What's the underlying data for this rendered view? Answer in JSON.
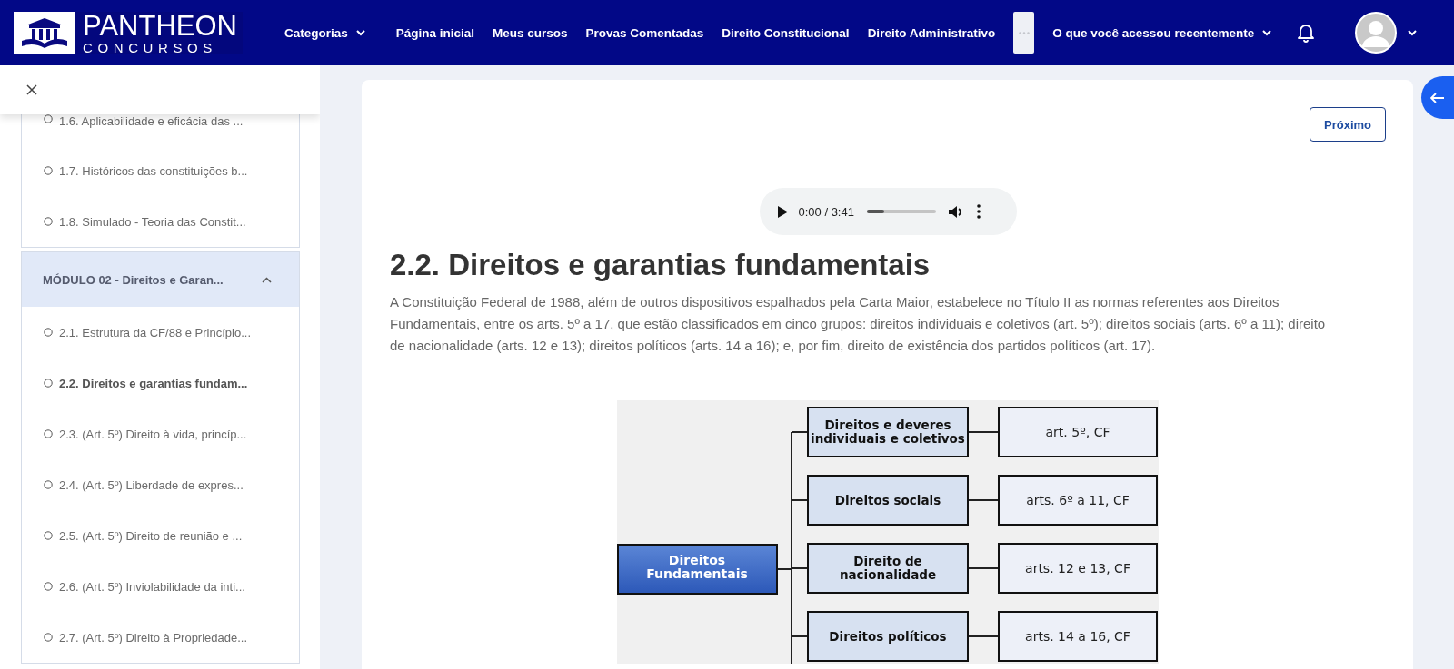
{
  "header": {
    "logo": {
      "title": "PANTHEON",
      "subtitle": "CONCURSOS"
    },
    "nav": [
      {
        "label": "Categorias",
        "kind": "dropdown"
      },
      {
        "label": "Página inicial",
        "kind": "link"
      },
      {
        "label": "Meus cursos",
        "kind": "link"
      },
      {
        "label": "Provas Comentadas",
        "kind": "link"
      },
      {
        "label": "Direito Constitucional",
        "kind": "link"
      },
      {
        "label": "Direito Administrativo",
        "kind": "link"
      },
      {
        "label": "O que você acessou recentemente",
        "kind": "dropdown"
      }
    ]
  },
  "sidebar": {
    "modules": [
      {
        "items": [
          {
            "label": "1.6. Aplicabilidade e eficácia das ...",
            "selected": false
          },
          {
            "label": "1.7. Históricos das constituições b...",
            "selected": false
          },
          {
            "label": "1.8. Simulado - Teoria das Constit...",
            "selected": false
          }
        ]
      },
      {
        "title": "MÓDULO 02 - Direitos e Garan...",
        "expanded": true,
        "items": [
          {
            "label": "2.1. Estrutura da CF/88 e Princípio...",
            "selected": false
          },
          {
            "label": "2.2. Direitos e garantias fundam...",
            "selected": true
          },
          {
            "label": "2.3. (Art. 5º) Direito à vida, princíp...",
            "selected": false
          },
          {
            "label": "2.4. (Art. 5º) Liberdade de expres...",
            "selected": false
          },
          {
            "label": "2.5. (Art. 5º) Direito de reunião e ...",
            "selected": false
          },
          {
            "label": "2.6. (Art. 5º) Inviolabilidade da inti...",
            "selected": false
          },
          {
            "label": "2.7. (Art. 5º) Direito à Propriedade...",
            "selected": false
          }
        ]
      }
    ]
  },
  "content": {
    "next_button": "Próximo",
    "audio": {
      "time": "0:00 / 3:41",
      "level": 0.25
    },
    "title": "2.2. Direitos e garantias fundamentais",
    "paragraph": "A Constituição Federal de 1988, além de outros dispositivos espalhados pela Carta Maior, estabelece no Título II as normas referentes aos Direitos Fundamentais, entre os arts. 5º a 17, que estão classificados em cinco grupos: direitos individuais e coletivos (art. 5º); direitos sociais (arts. 6º a 11); direito de nacionalidade (arts. 12 e 13); direitos políticos (arts. 14 a 16); e, por fim, direito de existência dos partidos políticos (art. 17).",
    "diagram": {
      "root": [
        "Direitos",
        "Fundamentais"
      ],
      "branches": [
        {
          "label": [
            "Direitos e deveres",
            "individuais  e coletivos"
          ],
          "reference": "art. 5º, CF"
        },
        {
          "label": [
            "Direitos sociais"
          ],
          "reference": "arts. 6º a 11, CF"
        },
        {
          "label": [
            "Direito de",
            "nacionalidade"
          ],
          "reference": "arts. 12 e 13, CF"
        },
        {
          "label": [
            "Direitos políticos"
          ],
          "reference": "arts. 14 a 16, CF"
        }
      ]
    }
  }
}
